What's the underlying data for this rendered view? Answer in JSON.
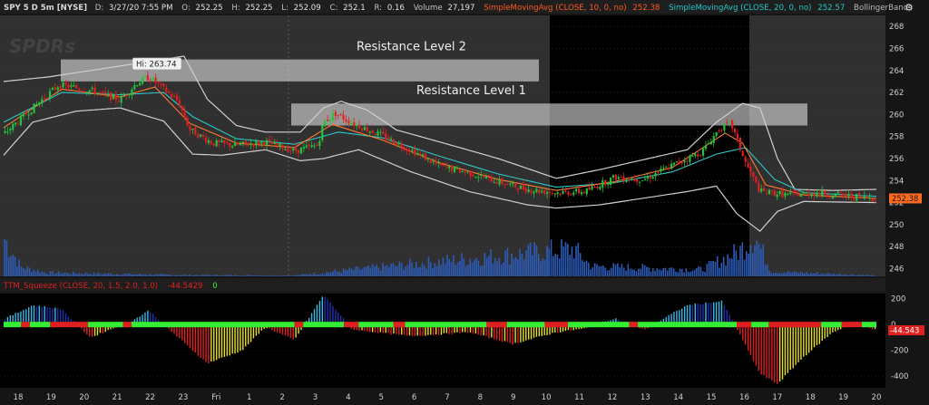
{
  "header": {
    "symbol_title": "SPY 5 D 5m [NYSE]",
    "fields": [
      {
        "label": "D:",
        "value": "3/27/20 7:55 PM"
      },
      {
        "label": "O:",
        "value": "252.25"
      },
      {
        "label": "H:",
        "value": "252.25"
      },
      {
        "label": "L:",
        "value": "252.09"
      },
      {
        "label": "C:",
        "value": "252.1"
      },
      {
        "label": "R:",
        "value": "0.16"
      },
      {
        "label": "Volume",
        "value": "27,197"
      }
    ],
    "studies": [
      {
        "name": "SimpleMovingAvg (CLOSE, 10, 0, no)",
        "value": "252.38",
        "color": "#ff5a1f"
      },
      {
        "name": "SimpleMovingAvg (CLOSE, 20, 0, no)",
        "value": "252.57",
        "color": "#22c8c8"
      },
      {
        "name": "BollingerBands",
        "value": "",
        "color": "#b8b8b8"
      }
    ]
  },
  "watermark": "SPDRs",
  "upper_panel": {
    "y_ticks": [
      "268",
      "266",
      "264",
      "262",
      "260",
      "258",
      "256",
      "254",
      "252",
      "250",
      "248",
      "246"
    ],
    "last_price_label": "252.38",
    "high_marker_label": "Hi: 263.74",
    "annotations": [
      {
        "label": "Resistance Level 2",
        "low": 263.0,
        "high": 265.0
      },
      {
        "label": "Resistance Level 1",
        "low": 259.0,
        "high": 261.0
      }
    ]
  },
  "lower_panel": {
    "study_title": "TTM_Squeeze (CLOSE, 20, 1.5, 2.0, 1.0)",
    "value_label": "-44.5429",
    "signal_label": "0",
    "y_ticks": [
      "200",
      "0",
      "-200",
      "-400"
    ],
    "last_value_label": "-44.543"
  },
  "x_axis": {
    "ticks": [
      "18",
      "19",
      "20",
      "21",
      "22",
      "23",
      "Fri",
      "1",
      "2",
      "3",
      "4",
      "5",
      "6",
      "7",
      "8",
      "9",
      "10",
      "11",
      "12",
      "13",
      "14",
      "15",
      "16",
      "17",
      "18",
      "19",
      "20"
    ]
  },
  "colors": {
    "background": "#151515",
    "plot_area": "#303030",
    "extended_hours": "#000000",
    "candle_up": "#22c43c",
    "candle_down": "#e02020",
    "volume": "#2d5bb8",
    "bollinger": "#d0d0d0",
    "sma10": "#ff7a30",
    "sma20": "#2ec8c8",
    "resistance_band": "#d8d8d8",
    "momentum_up_strong": "#39b8e8",
    "momentum_up_weak": "#2030b0",
    "momentum_down_strong": "#e02020",
    "momentum_down_weak": "#e8e020",
    "squeeze_on": "#e02020",
    "squeeze_off": "#33ee33"
  },
  "chart_data": {
    "type": "candlestick",
    "symbol": "SPY",
    "period": "5 D",
    "interval": "5m",
    "price_range": [
      245.3,
      269.0
    ],
    "momentum_range": [
      -490,
      240
    ],
    "hi": 263.74,
    "last": 252.38,
    "price_path": [
      {
        "t": 0.0,
        "p": 258.2
      },
      {
        "t": 1.3,
        "p": 261.3
      },
      {
        "t": 1.9,
        "p": 262.7
      },
      {
        "t": 3.0,
        "p": 262.2
      },
      {
        "t": 4.0,
        "p": 261.3
      },
      {
        "t": 4.6,
        "p": 262.9
      },
      {
        "t": 5.0,
        "p": 263.4
      },
      {
        "t": 6.0,
        "p": 261.2
      },
      {
        "t": 6.4,
        "p": 258.6
      },
      {
        "t": 7.2,
        "p": 257.4
      },
      {
        "t": 8.0,
        "p": 257.2
      },
      {
        "t": 9.0,
        "p": 257.5
      },
      {
        "t": 10.0,
        "p": 256.7
      },
      {
        "t": 10.8,
        "p": 257.2
      },
      {
        "t": 11.0,
        "p": 259.3
      },
      {
        "t": 11.4,
        "p": 260.1
      },
      {
        "t": 12.0,
        "p": 259.2
      },
      {
        "t": 13.0,
        "p": 258.1
      },
      {
        "t": 14.0,
        "p": 256.8
      },
      {
        "t": 15.0,
        "p": 255.3
      },
      {
        "t": 16.0,
        "p": 254.7
      },
      {
        "t": 17.0,
        "p": 253.9
      },
      {
        "t": 18.0,
        "p": 253.2
      },
      {
        "t": 19.0,
        "p": 252.9
      },
      {
        "t": 20.0,
        "p": 253.0
      },
      {
        "t": 21.0,
        "p": 254.3
      },
      {
        "t": 22.0,
        "p": 254.1
      },
      {
        "t": 23.0,
        "p": 255.4
      },
      {
        "t": 24.0,
        "p": 256.6
      },
      {
        "t": 24.6,
        "p": 258.7
      },
      {
        "t": 25.0,
        "p": 259.2
      },
      {
        "t": 25.5,
        "p": 255.6
      },
      {
        "t": 26.0,
        "p": 253.0
      },
      {
        "t": 27.0,
        "p": 252.7
      },
      {
        "t": 28.0,
        "p": 252.9
      },
      {
        "t": 29.0,
        "p": 252.6
      },
      {
        "t": 30.0,
        "p": 252.4
      }
    ],
    "upper_band": [
      {
        "t": 0.0,
        "p": 263.0
      },
      {
        "t": 1.5,
        "p": 263.4
      },
      {
        "t": 3.0,
        "p": 264.0
      },
      {
        "t": 5.0,
        "p": 264.8
      },
      {
        "t": 6.2,
        "p": 265.3
      },
      {
        "t": 7.0,
        "p": 261.4
      },
      {
        "t": 8.0,
        "p": 259.0
      },
      {
        "t": 9.0,
        "p": 258.4
      },
      {
        "t": 10.2,
        "p": 258.4
      },
      {
        "t": 11.0,
        "p": 260.6
      },
      {
        "t": 11.6,
        "p": 261.2
      },
      {
        "t": 12.5,
        "p": 260.4
      },
      {
        "t": 13.5,
        "p": 258.6
      },
      {
        "t": 15.0,
        "p": 257.5
      },
      {
        "t": 17.0,
        "p": 256.0
      },
      {
        "t": 19.0,
        "p": 254.2
      },
      {
        "t": 20.5,
        "p": 255.0
      },
      {
        "t": 22.0,
        "p": 255.9
      },
      {
        "t": 23.5,
        "p": 256.8
      },
      {
        "t": 24.5,
        "p": 259.3
      },
      {
        "t": 25.4,
        "p": 261.0
      },
      {
        "t": 26.0,
        "p": 260.6
      },
      {
        "t": 26.6,
        "p": 256.0
      },
      {
        "t": 27.2,
        "p": 253.2
      },
      {
        "t": 28.5,
        "p": 253.1
      },
      {
        "t": 30.0,
        "p": 253.2
      }
    ],
    "lower_band": [
      {
        "t": 0.0,
        "p": 256.3
      },
      {
        "t": 1.0,
        "p": 259.3
      },
      {
        "t": 2.5,
        "p": 260.3
      },
      {
        "t": 4.0,
        "p": 260.6
      },
      {
        "t": 5.5,
        "p": 259.4
      },
      {
        "t": 6.5,
        "p": 256.4
      },
      {
        "t": 7.5,
        "p": 256.3
      },
      {
        "t": 9.0,
        "p": 256.8
      },
      {
        "t": 10.2,
        "p": 255.8
      },
      {
        "t": 11.0,
        "p": 256.0
      },
      {
        "t": 12.2,
        "p": 256.8
      },
      {
        "t": 14.0,
        "p": 254.8
      },
      {
        "t": 16.0,
        "p": 253.0
      },
      {
        "t": 18.0,
        "p": 251.8
      },
      {
        "t": 19.0,
        "p": 251.5
      },
      {
        "t": 20.5,
        "p": 251.8
      },
      {
        "t": 22.0,
        "p": 252.4
      },
      {
        "t": 23.5,
        "p": 253.0
      },
      {
        "t": 24.5,
        "p": 253.5
      },
      {
        "t": 25.2,
        "p": 251.0
      },
      {
        "t": 26.0,
        "p": 249.4
      },
      {
        "t": 26.6,
        "p": 251.2
      },
      {
        "t": 27.5,
        "p": 252.1
      },
      {
        "t": 30.0,
        "p": 252.0
      }
    ],
    "sma20_path": [
      {
        "t": 0.0,
        "p": 259.3
      },
      {
        "t": 2.0,
        "p": 262.0
      },
      {
        "t": 4.0,
        "p": 261.8
      },
      {
        "t": 5.5,
        "p": 262.0
      },
      {
        "t": 6.5,
        "p": 259.8
      },
      {
        "t": 8.0,
        "p": 257.8
      },
      {
        "t": 10.0,
        "p": 257.3
      },
      {
        "t": 11.5,
        "p": 258.4
      },
      {
        "t": 13.0,
        "p": 257.9
      },
      {
        "t": 15.0,
        "p": 256.2
      },
      {
        "t": 17.0,
        "p": 254.6
      },
      {
        "t": 19.0,
        "p": 253.4
      },
      {
        "t": 21.0,
        "p": 253.8
      },
      {
        "t": 23.0,
        "p": 254.8
      },
      {
        "t": 24.5,
        "p": 256.4
      },
      {
        "t": 25.5,
        "p": 257.0
      },
      {
        "t": 26.5,
        "p": 254.1
      },
      {
        "t": 27.5,
        "p": 252.9
      },
      {
        "t": 30.0,
        "p": 252.57
      }
    ],
    "sma10_path": [
      {
        "t": 0.0,
        "p": 258.8
      },
      {
        "t": 2.0,
        "p": 262.3
      },
      {
        "t": 4.0,
        "p": 261.6
      },
      {
        "t": 5.2,
        "p": 262.5
      },
      {
        "t": 6.4,
        "p": 259.2
      },
      {
        "t": 8.0,
        "p": 257.4
      },
      {
        "t": 10.0,
        "p": 257.0
      },
      {
        "t": 11.3,
        "p": 259.1
      },
      {
        "t": 13.0,
        "p": 257.7
      },
      {
        "t": 15.0,
        "p": 255.6
      },
      {
        "t": 17.0,
        "p": 254.1
      },
      {
        "t": 19.0,
        "p": 253.1
      },
      {
        "t": 21.0,
        "p": 253.9
      },
      {
        "t": 23.0,
        "p": 255.2
      },
      {
        "t": 24.8,
        "p": 258.3
      },
      {
        "t": 25.4,
        "p": 257.4
      },
      {
        "t": 26.2,
        "p": 253.6
      },
      {
        "t": 27.5,
        "p": 252.7
      },
      {
        "t": 30.0,
        "p": 252.38
      }
    ],
    "momentum_path": [
      {
        "t": 0.0,
        "p": 40
      },
      {
        "t": 1.0,
        "p": 150
      },
      {
        "t": 2.0,
        "p": 120
      },
      {
        "t": 2.5,
        "p": 0
      },
      {
        "t": 3.0,
        "p": -100
      },
      {
        "t": 4.5,
        "p": 40
      },
      {
        "t": 5.0,
        "p": 110
      },
      {
        "t": 5.5,
        "p": 0
      },
      {
        "t": 7.0,
        "p": -300
      },
      {
        "t": 8.2,
        "p": -200
      },
      {
        "t": 9.0,
        "p": -20
      },
      {
        "t": 10.0,
        "p": -120
      },
      {
        "t": 11.0,
        "p": 230
      },
      {
        "t": 12.0,
        "p": -40
      },
      {
        "t": 14.0,
        "p": -90
      },
      {
        "t": 16.0,
        "p": -60
      },
      {
        "t": 17.5,
        "p": -150
      },
      {
        "t": 19.0,
        "p": -60
      },
      {
        "t": 20.0,
        "p": -30
      },
      {
        "t": 21.0,
        "p": 50
      },
      {
        "t": 22.0,
        "p": -40
      },
      {
        "t": 23.5,
        "p": 150
      },
      {
        "t": 24.7,
        "p": 180
      },
      {
        "t": 25.2,
        "p": -30
      },
      {
        "t": 26.0,
        "p": -380
      },
      {
        "t": 26.6,
        "p": -460
      },
      {
        "t": 27.5,
        "p": -250
      },
      {
        "t": 28.5,
        "p": -60
      },
      {
        "t": 29.3,
        "p": 20
      },
      {
        "t": 30.0,
        "p": -44.5
      }
    ],
    "volume_profile": [
      {
        "t": 0.0,
        "v": 0.85
      },
      {
        "t": 0.6,
        "v": 0.2
      },
      {
        "t": 1.5,
        "v": 0.08
      },
      {
        "t": 6.0,
        "v": 0.03
      },
      {
        "t": 10.0,
        "v": 0.02
      },
      {
        "t": 19.6,
        "v": 0.6
      },
      {
        "t": 20.2,
        "v": 0.22
      },
      {
        "t": 24.0,
        "v": 0.15
      },
      {
        "t": 25.3,
        "v": 0.55
      },
      {
        "t": 25.8,
        "v": 0.9
      },
      {
        "t": 26.4,
        "v": 0.1
      },
      {
        "t": 30.0,
        "v": 0.02
      }
    ],
    "squeeze_dots": [
      {
        "from": 0.0,
        "to": 0.6,
        "state": "off"
      },
      {
        "from": 0.6,
        "to": 0.9,
        "state": "on"
      },
      {
        "from": 0.9,
        "to": 1.6,
        "state": "off"
      },
      {
        "from": 1.6,
        "to": 2.9,
        "state": "on"
      },
      {
        "from": 2.9,
        "to": 4.1,
        "state": "off"
      },
      {
        "from": 4.1,
        "to": 4.4,
        "state": "on"
      },
      {
        "from": 4.4,
        "to": 10.0,
        "state": "off"
      },
      {
        "from": 10.0,
        "to": 10.3,
        "state": "on"
      },
      {
        "from": 10.3,
        "to": 11.7,
        "state": "off"
      },
      {
        "from": 11.7,
        "to": 12.2,
        "state": "on"
      },
      {
        "from": 12.2,
        "to": 13.4,
        "state": "off"
      },
      {
        "from": 13.4,
        "to": 13.8,
        "state": "on"
      },
      {
        "from": 13.8,
        "to": 16.6,
        "state": "off"
      },
      {
        "from": 16.6,
        "to": 17.3,
        "state": "on"
      },
      {
        "from": 17.3,
        "to": 18.6,
        "state": "off"
      },
      {
        "from": 18.6,
        "to": 19.4,
        "state": "on"
      },
      {
        "from": 19.4,
        "to": 21.5,
        "state": "off"
      },
      {
        "from": 21.5,
        "to": 21.8,
        "state": "on"
      },
      {
        "from": 21.8,
        "to": 25.2,
        "state": "off"
      },
      {
        "from": 25.2,
        "to": 25.7,
        "state": "on"
      },
      {
        "from": 25.7,
        "to": 26.3,
        "state": "off"
      },
      {
        "from": 26.3,
        "to": 28.1,
        "state": "on"
      },
      {
        "from": 28.1,
        "to": 28.8,
        "state": "off"
      },
      {
        "from": 28.8,
        "to": 29.5,
        "state": "on"
      },
      {
        "from": 29.5,
        "to": 30.0,
        "state": "off"
      }
    ]
  }
}
